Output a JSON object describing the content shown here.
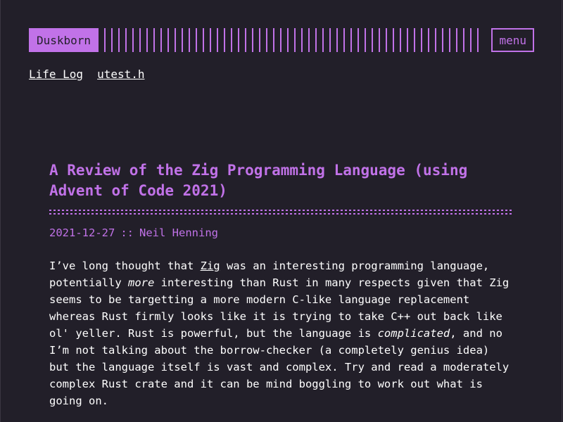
{
  "header": {
    "logo_text": "Duskborn",
    "menu_label": "menu"
  },
  "nav": {
    "items": [
      "Life Log",
      "utest.h"
    ]
  },
  "post": {
    "title": "A Review of the Zig Programming Language (using Advent of Code 2021)",
    "date": "2021-12-27",
    "separator": "::",
    "author": "Neil Henning",
    "body": {
      "p1": "I’ve long thought that ",
      "link_zig": "Zig",
      "p2": " was an interesting programming language, potentially ",
      "em_more": "more",
      "p3": " interesting than Rust in many respects given that Zig seems to be targetting a more modern C-like language replacement whereas Rust firmly looks like it is trying to take C++ out back like ol' yeller. Rust is powerful, but the language is ",
      "em_complicated": "complicated",
      "p4": ", and no I’m not talking about the borrow-checker (a completely genius idea) but the language itself is vast and complex. Try and read a moderately complex Rust crate and it can be mind boggling to work out what is going on."
    }
  },
  "colors": {
    "background": "#221f29",
    "accent": "#c172e8",
    "text": "#ffffff"
  }
}
